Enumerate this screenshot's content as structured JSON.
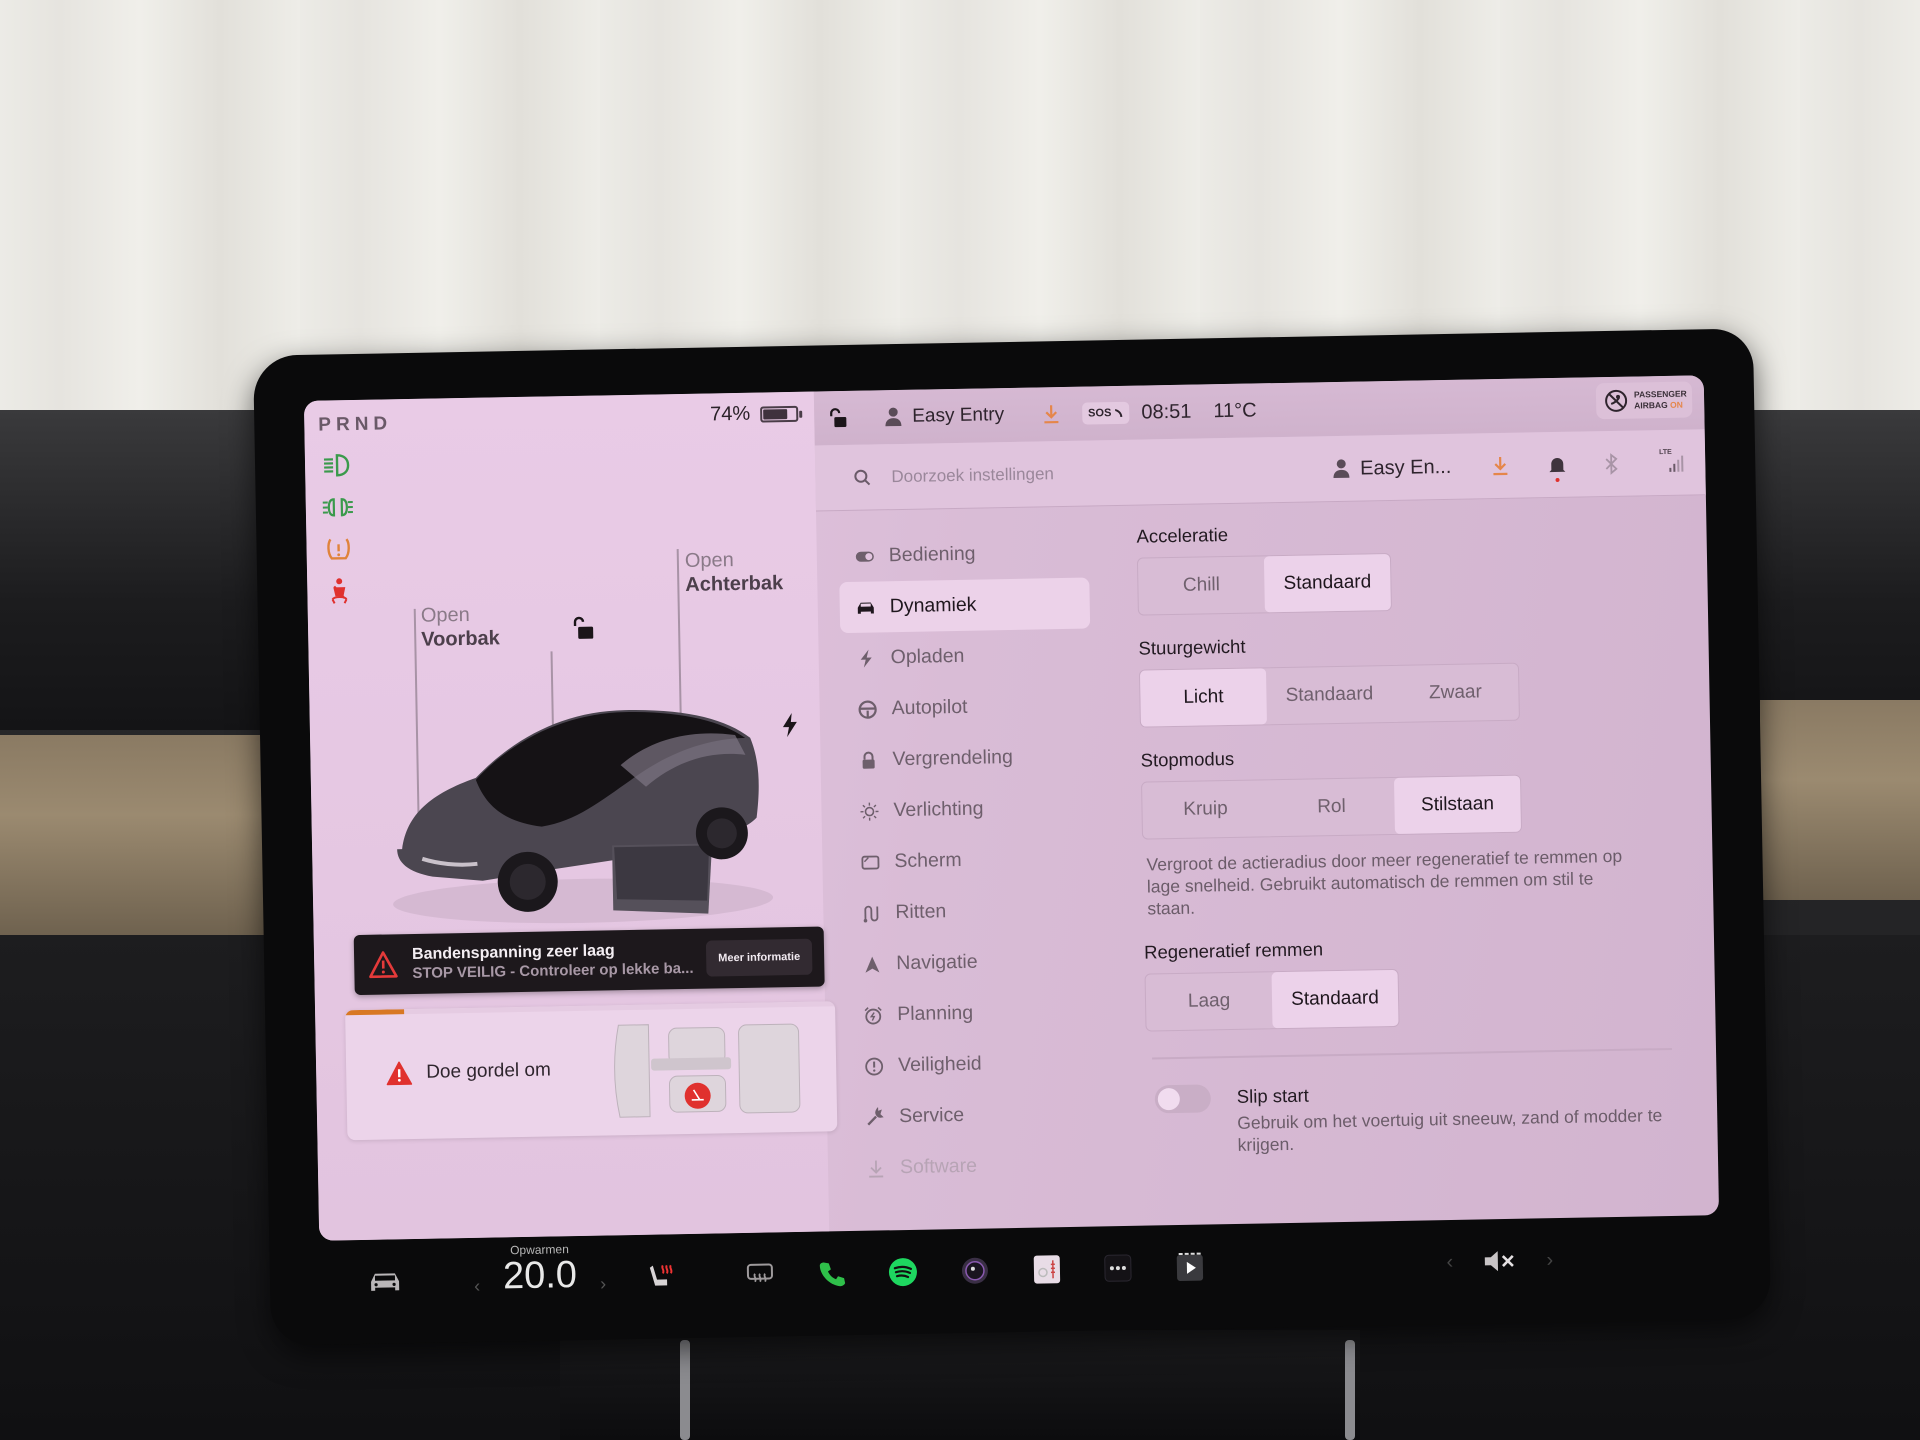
{
  "car_panel": {
    "gear_selector": "PRND",
    "battery_percent_label": "74%",
    "battery_level": 0.74,
    "telltales": [
      "low-beam-headlights-icon",
      "parking-lights-icon",
      "tire-pressure-warning-icon",
      "seatbelt-warning-icon"
    ],
    "frunk": {
      "action": "Open",
      "target": "Voorbak"
    },
    "trunk": {
      "action": "Open",
      "target": "Achterbak"
    },
    "lock_state": "unlocked",
    "charge_port_icon": "bolt-icon",
    "alert": {
      "title": "Bandenspanning zeer laag",
      "subtitle": "STOP VEILIG - Controleer op lekke ba...",
      "button": "Meer informatie"
    },
    "seatbelt_card": {
      "message": "Doe gordel om",
      "progress": 0.12
    }
  },
  "status_bar": {
    "profile": "Easy Entry",
    "sos_label": "SOS",
    "time": "08:51",
    "temperature": "11°C",
    "airbag_line1": "PASSENGER",
    "airbag_line2": "AIRBAG",
    "airbag_state": "ON"
  },
  "settings_header": {
    "search_placeholder": "Doorzoek instellingen",
    "profile_short": "Easy En...",
    "network": "LTE"
  },
  "nav": {
    "active": "Dynamiek",
    "items": [
      {
        "label": "Bediening",
        "icon": "toggle-icon"
      },
      {
        "label": "Dynamiek",
        "icon": "car-icon"
      },
      {
        "label": "Opladen",
        "icon": "bolt-icon"
      },
      {
        "label": "Autopilot",
        "icon": "steering-wheel-icon"
      },
      {
        "label": "Vergrendeling",
        "icon": "lock-icon"
      },
      {
        "label": "Verlichting",
        "icon": "sun-icon"
      },
      {
        "label": "Scherm",
        "icon": "display-icon"
      },
      {
        "label": "Ritten",
        "icon": "trips-icon"
      },
      {
        "label": "Navigatie",
        "icon": "navigation-arrow-icon"
      },
      {
        "label": "Planning",
        "icon": "alarm-clock-icon"
      },
      {
        "label": "Veiligheid",
        "icon": "alert-circle-icon"
      },
      {
        "label": "Service",
        "icon": "wrench-icon"
      },
      {
        "label": "Software",
        "icon": "download-icon"
      }
    ]
  },
  "dynamics": {
    "acceleratie": {
      "label": "Acceleratie",
      "options": [
        "Chill",
        "Standaard"
      ],
      "selected": 1
    },
    "stuurgewicht": {
      "label": "Stuurgewicht",
      "options": [
        "Licht",
        "Standaard",
        "Zwaar"
      ],
      "selected": 0
    },
    "stopmodus": {
      "label": "Stopmodus",
      "options": [
        "Kruip",
        "Rol",
        "Stilstaan"
      ],
      "selected": 2,
      "description": "Vergroot de actieradius door meer regeneratief te remmen op lage snelheid. Gebruikt automatisch de remmen om stil te staan."
    },
    "regeneratief": {
      "label": "Regeneratief remmen",
      "options": [
        "Laag",
        "Standaard"
      ],
      "selected": 1
    },
    "slip_start": {
      "label": "Slip start",
      "enabled": false,
      "description": "Gebruik om het voertuig uit sneeuw, zand of modder te krijgen."
    }
  },
  "taskbar": {
    "climate_label": "Opwarmen",
    "climate_temp": "20.0",
    "volume": "muted",
    "apps": [
      "car-icon",
      "seat-heater-icon",
      "rear-defrost-icon",
      "phone-icon",
      "spotify-icon",
      "camera-icon",
      "toybox-icon",
      "more-apps-icon",
      "theater-icon"
    ]
  },
  "colors": {
    "screen_bg": "#e2c4df",
    "accent_orange": "#e5864a",
    "warning_red": "#e0312e",
    "telltale_green": "#3a9a4c",
    "phone_green": "#2fbf4a",
    "spotify_green": "#1ed760"
  }
}
